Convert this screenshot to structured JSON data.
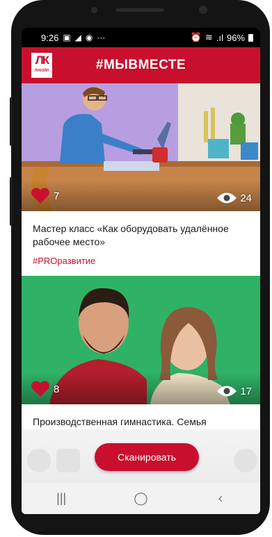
{
  "status_bar": {
    "time": "9:26",
    "icons_left": [
      "gallery-icon",
      "send-icon",
      "browser-icon",
      "more-icon"
    ],
    "more": "···",
    "battery": "96%"
  },
  "header": {
    "logo_mark": "ЛК",
    "logo_word": "ЛУКОЙЛ",
    "title": "#МЫВМЕСТЕ",
    "accent_color": "#c8102e"
  },
  "posts": [
    {
      "likes": "7",
      "views": "24",
      "text": "Мастер класс «Как оборудовать удалённое рабочее место»",
      "tag": "#PROразвитие"
    },
    {
      "likes": "8",
      "views": "17",
      "text": "Производственная гимнастика. Семья Шалиновых, ЛУКОЙЛ-ПЕРМЬ",
      "tag": ""
    }
  ],
  "scan_button": "Сканировать",
  "nav": {
    "recent": "|||",
    "home": "◯",
    "back": "‹"
  }
}
